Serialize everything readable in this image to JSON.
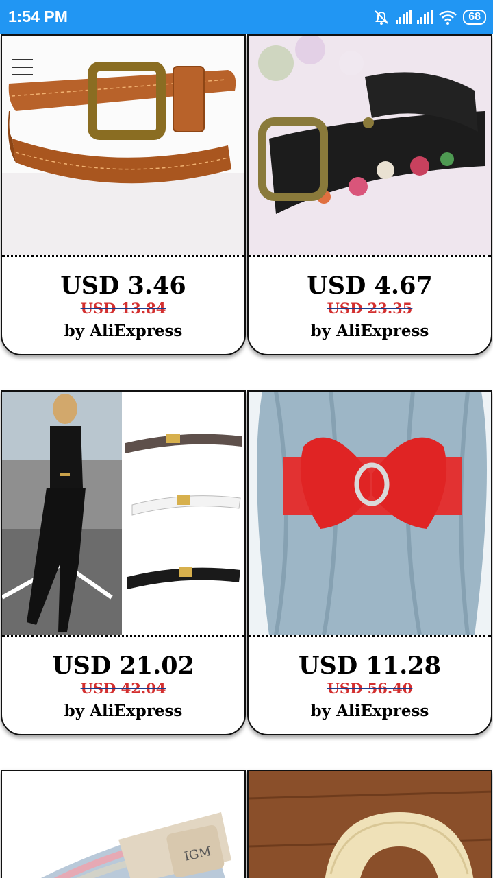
{
  "status_bar": {
    "time": "1:54 PM",
    "battery": "68"
  },
  "products": [
    {
      "price": "USD 3.46",
      "old_price": "USD 13.84",
      "seller": "by AliExpress",
      "image": "brown-leather-belt"
    },
    {
      "price": "USD 4.67",
      "old_price": "USD 23.35",
      "seller": "by AliExpress",
      "image": "black-floral-belt"
    },
    {
      "price": "USD 21.02",
      "old_price": "USD 42.04",
      "seller": "by AliExpress",
      "image": "thin-belts-model"
    },
    {
      "price": "USD 11.28",
      "old_price": "USD 56.40",
      "seller": "by AliExpress",
      "image": "red-bow-belt"
    }
  ],
  "partial_products": [
    {
      "image": "braided-elastic-belt"
    },
    {
      "image": "canvas-belt"
    }
  ],
  "colors": {
    "status_bar": "#2196f3",
    "old_price": "#d32f2f",
    "strike": "#1a3c8e"
  }
}
